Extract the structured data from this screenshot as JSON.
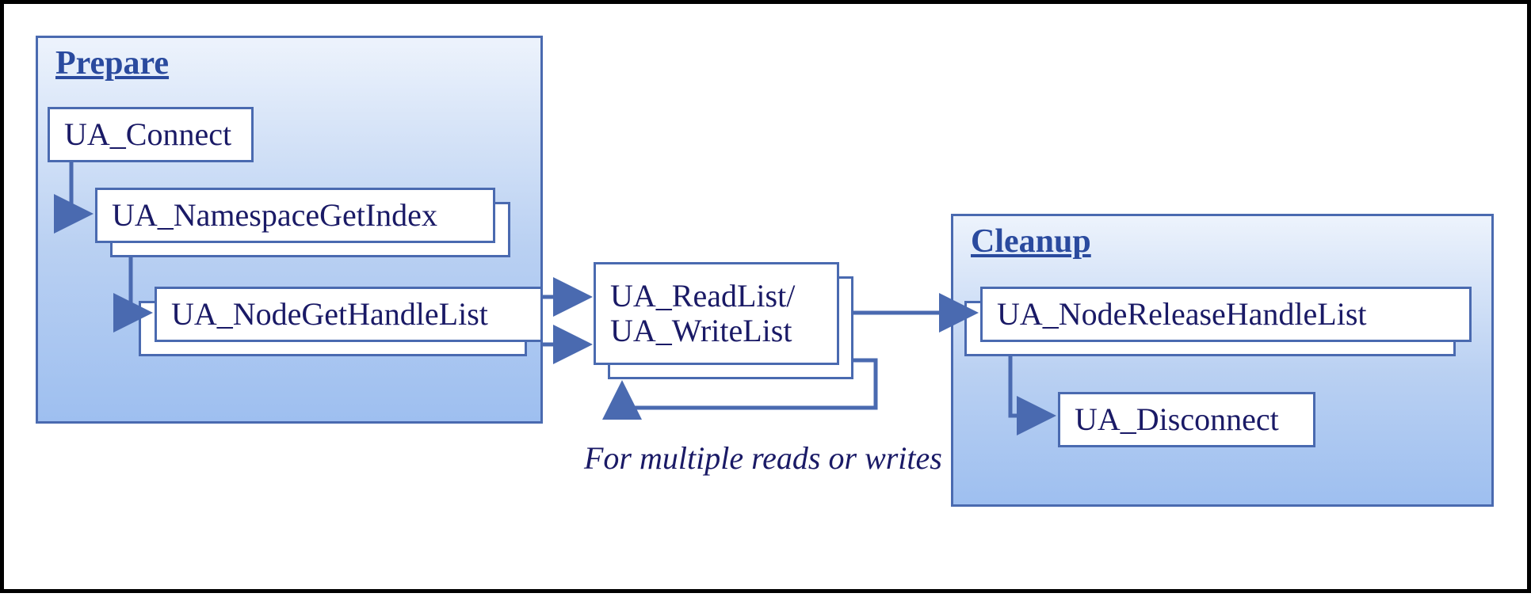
{
  "colors": {
    "panel_border": "#4a6ab0",
    "panel_fill_top": "#edf3fc",
    "panel_fill_bottom": "#9ebff0",
    "text": "#1a1a66",
    "title": "#2a4a9e"
  },
  "panels": {
    "prepare": {
      "title": "Prepare"
    },
    "cleanup": {
      "title": "Cleanup"
    }
  },
  "boxes": {
    "connect": "UA_Connect",
    "ns_get_index": "UA_NamespaceGetIndex",
    "node_get_handle": "UA_NodeGetHandleList",
    "read_write_line1": "UA_ReadList/",
    "read_write_line2": "UA_WriteList",
    "node_release_handle": "UA_NodeReleaseHandleList",
    "disconnect": "UA_Disconnect"
  },
  "caption": "For multiple reads or writes"
}
